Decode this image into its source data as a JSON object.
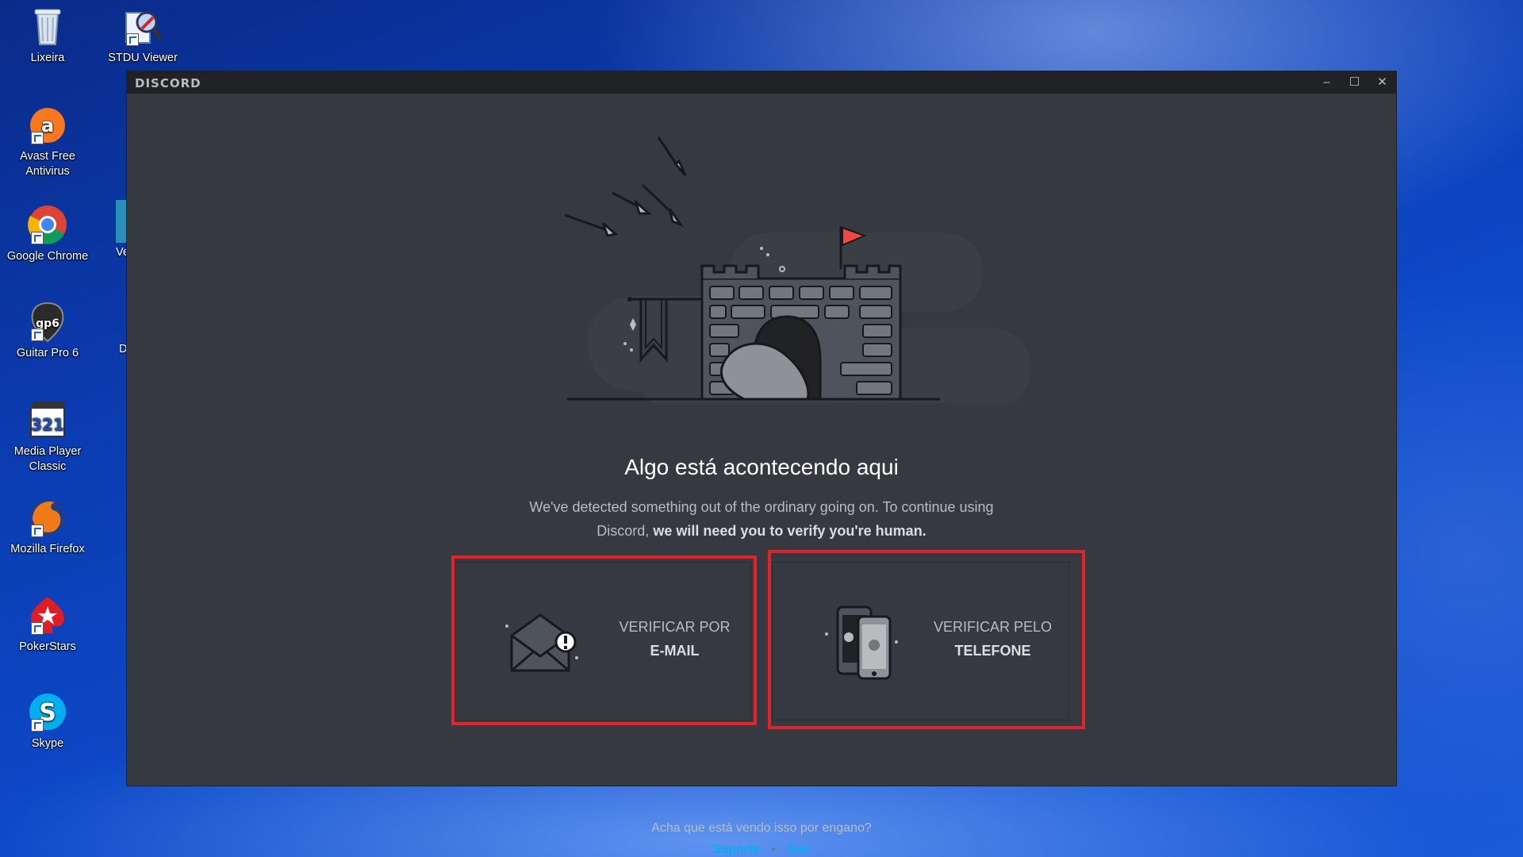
{
  "desktop": {
    "icons": [
      {
        "label": "Lixeira",
        "icon": "recycle-bin-icon"
      },
      {
        "label": "STDU Viewer",
        "icon": "stdu-viewer-icon"
      },
      {
        "label": "Avast Free Antivirus",
        "icon": "avast-icon"
      },
      {
        "label": "Google Chrome",
        "icon": "chrome-icon"
      },
      {
        "label": "Guitar Pro 6",
        "icon": "guitar-pro-icon"
      },
      {
        "label": "Media Player Classic",
        "icon": "media-player-classic-icon"
      },
      {
        "label": "Mozilla Firefox",
        "icon": "firefox-icon"
      },
      {
        "label": "PokerStars",
        "icon": "pokerstars-icon"
      },
      {
        "label": "Skype",
        "icon": "skype-icon"
      }
    ],
    "partial_labels": [
      "Veg",
      "D"
    ]
  },
  "window": {
    "brand": "DISCORD",
    "controls": {
      "minimize": "–",
      "maximize": "☐",
      "close": "✕"
    }
  },
  "verify": {
    "title": "Algo está acontecendo aqui",
    "desc_plain": "We've detected something out of the ordinary going on. To continue using Discord,",
    "desc_bold": "we will need you to verify you're human.",
    "email_card": {
      "line1": "VERIFICAR POR",
      "line2": "E-MAIL",
      "icon": "envelope-alert-icon"
    },
    "phone_card": {
      "line1": "VERIFICAR PELO",
      "line2": "TELEFONE",
      "icon": "phones-icon"
    },
    "footer_question": "Acha que está vendo isso por engano?",
    "support_link": "Suporte",
    "logout_link": "Sair"
  },
  "colors": {
    "window_bg": "#36393f",
    "titlebar_bg": "#202225",
    "highlight": "#e3222a",
    "link": "#00b0f4",
    "flag": "#f04747"
  }
}
